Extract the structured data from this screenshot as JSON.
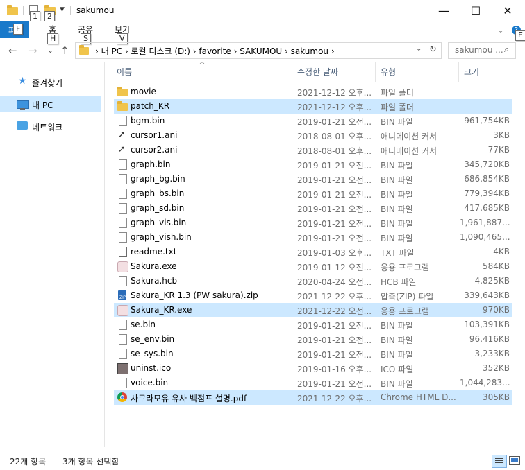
{
  "window": {
    "title": "sakumou",
    "minimize": "—",
    "maximize": "☐",
    "close": "✕"
  },
  "keytips": {
    "qa1": "1",
    "qa2": "2",
    "file": "F",
    "home": "H",
    "share": "S",
    "view": "V",
    "help": "E"
  },
  "ribbon": {
    "file_label": "파일",
    "tabs": [
      "홈",
      "공유",
      "보기"
    ],
    "help_icon": "?"
  },
  "nav": {
    "back": "←",
    "forward": "→",
    "recent": "⌄",
    "up": "↑",
    "refresh": "↻",
    "path": "›  내 PC  ›  로컬 디스크 (D:)  ›  favorite  ›  SAKUMOU  ›  sakumou  ›",
    "search_placeholder": "sakumou ...",
    "search_icon": "⌕"
  },
  "navpane": {
    "items": [
      {
        "label": "즐겨찾기",
        "icon": "star-icon"
      },
      {
        "label": "내 PC",
        "icon": "computer-icon",
        "selected": true
      },
      {
        "label": "네트워크",
        "icon": "network-icon"
      }
    ]
  },
  "columns": {
    "name": "이름",
    "date": "수정한 날짜",
    "type": "유형",
    "size": "크기",
    "sort_indicator": "^"
  },
  "files": [
    {
      "name": "movie",
      "date": "2021-12-12 오후...",
      "type": "파일 폴더",
      "size": "",
      "icon": "folder-icon"
    },
    {
      "name": "patch_KR",
      "date": "2021-12-12 오후...",
      "type": "파일 폴더",
      "size": "",
      "icon": "folder-icon",
      "selected": true
    },
    {
      "name": "bgm.bin",
      "date": "2019-01-21 오전...",
      "type": "BIN 파일",
      "size": "961,754KB",
      "icon": "file-icon"
    },
    {
      "name": "cursor1.ani",
      "date": "2018-08-01 오후...",
      "type": "애니메이션 커서",
      "size": "3KB",
      "icon": "cursor-icon"
    },
    {
      "name": "cursor2.ani",
      "date": "2018-08-01 오후...",
      "type": "애니메이션 커서",
      "size": "77KB",
      "icon": "cursor-icon"
    },
    {
      "name": "graph.bin",
      "date": "2019-01-21 오전...",
      "type": "BIN 파일",
      "size": "345,720KB",
      "icon": "file-icon"
    },
    {
      "name": "graph_bg.bin",
      "date": "2019-01-21 오전...",
      "type": "BIN 파일",
      "size": "686,854KB",
      "icon": "file-icon"
    },
    {
      "name": "graph_bs.bin",
      "date": "2019-01-21 오전...",
      "type": "BIN 파일",
      "size": "779,394KB",
      "icon": "file-icon"
    },
    {
      "name": "graph_sd.bin",
      "date": "2019-01-21 오전...",
      "type": "BIN 파일",
      "size": "417,685KB",
      "icon": "file-icon"
    },
    {
      "name": "graph_vis.bin",
      "date": "2019-01-21 오전...",
      "type": "BIN 파일",
      "size": "1,961,887...",
      "icon": "file-icon"
    },
    {
      "name": "graph_vish.bin",
      "date": "2019-01-21 오전...",
      "type": "BIN 파일",
      "size": "1,090,465...",
      "icon": "file-icon"
    },
    {
      "name": "readme.txt",
      "date": "2019-01-03 오후...",
      "type": "TXT 파일",
      "size": "4KB",
      "icon": "text-file-icon"
    },
    {
      "name": "Sakura.exe",
      "date": "2019-01-12 오전...",
      "type": "응용 프로그램",
      "size": "584KB",
      "icon": "app-icon"
    },
    {
      "name": "Sakura.hcb",
      "date": "2020-04-24 오전...",
      "type": "HCB 파일",
      "size": "4,825KB",
      "icon": "file-icon"
    },
    {
      "name": "Sakura_KR 1.3 (PW sakura).zip",
      "date": "2021-12-22 오후...",
      "type": "압축(ZIP) 파일",
      "size": "339,643KB",
      "icon": "zip-icon"
    },
    {
      "name": "Sakura_KR.exe",
      "date": "2021-12-22 오전...",
      "type": "응용 프로그램",
      "size": "970KB",
      "icon": "app-icon",
      "selected": true
    },
    {
      "name": "se.bin",
      "date": "2019-01-21 오전...",
      "type": "BIN 파일",
      "size": "103,391KB",
      "icon": "file-icon"
    },
    {
      "name": "se_env.bin",
      "date": "2019-01-21 오전...",
      "type": "BIN 파일",
      "size": "96,416KB",
      "icon": "file-icon"
    },
    {
      "name": "se_sys.bin",
      "date": "2019-01-21 오전...",
      "type": "BIN 파일",
      "size": "3,233KB",
      "icon": "file-icon"
    },
    {
      "name": "uninst.ico",
      "date": "2019-01-16 오후...",
      "type": "ICO 파일",
      "size": "352KB",
      "icon": "image-icon"
    },
    {
      "name": "voice.bin",
      "date": "2019-01-21 오전...",
      "type": "BIN 파일",
      "size": "1,044,283...",
      "icon": "file-icon"
    },
    {
      "name": "사쿠라모유 유사 백점프 설명.pdf",
      "date": "2021-12-22 오후...",
      "type": "Chrome HTML D...",
      "size": "305KB",
      "icon": "chrome-icon",
      "selected": true
    }
  ],
  "status": {
    "count": "22개 항목",
    "selected": "3개 항목 선택함"
  },
  "colors": {
    "accent": "#1979ca",
    "selection": "#cce8ff",
    "folder": "#f0c44c"
  }
}
